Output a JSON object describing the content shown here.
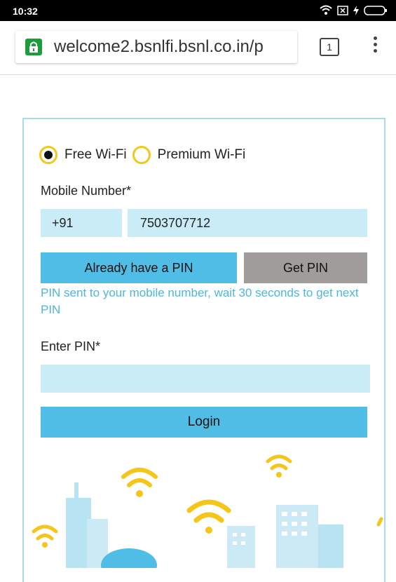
{
  "status_bar": {
    "time": "10:32"
  },
  "browser": {
    "url": "welcome2.bsnlfi.bsnl.co.in/p",
    "tab_count": "1"
  },
  "form": {
    "plan_options": [
      {
        "label": "Free Wi-Fi",
        "selected": true
      },
      {
        "label": "Premium Wi-Fi",
        "selected": false
      }
    ],
    "mobile_label": "Mobile Number*",
    "country_code": "+91",
    "mobile_number": "7503707712",
    "already_have_pin_label": "Already have a PIN",
    "get_pin_label": "Get PIN",
    "pin_message": "PIN sent to your mobile number, wait 30 seconds to get next PIN",
    "pin_label": "Enter PIN*",
    "pin_value": "",
    "login_label": "Login"
  },
  "colors": {
    "accent": "#50bde6",
    "field": "#c9ecf7",
    "radio": "#f2c81b",
    "wifi": "#f5c518"
  }
}
